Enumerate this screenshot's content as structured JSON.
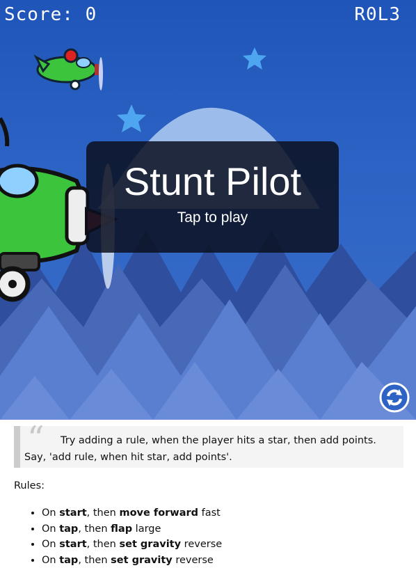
{
  "hud": {
    "score_label": "Score:",
    "score_value": "0",
    "level": "R0L3"
  },
  "overlay": {
    "title": "Stunt Pilot",
    "subtitle": "Tap to play"
  },
  "refresh": {
    "icon": "refresh-icon"
  },
  "quote": {
    "text": "Try adding a rule, when the player hits a star, then add points. Say, 'add rule, when hit star, add points'."
  },
  "rules": {
    "label": "Rules:",
    "items": [
      {
        "p1": "On ",
        "b1": "start",
        "p2": ", then ",
        "b2": "move forward",
        "p3": " fast"
      },
      {
        "p1": "On ",
        "b1": "tap",
        "p2": ", then ",
        "b2": "flap",
        "p3": " large"
      },
      {
        "p1": "On ",
        "b1": "start",
        "p2": ", then ",
        "b2": "set gravity",
        "p3": " reverse"
      },
      {
        "p1": "On ",
        "b1": "tap",
        "p2": ", then ",
        "b2": "set gravity",
        "p3": " reverse"
      }
    ]
  },
  "colors": {
    "sky": "#2c63c4",
    "trees_dark": "#2f4f9e",
    "trees_light": "#5b7fd0",
    "star": "#4ea6f0",
    "plane_green": "#3cc43c"
  }
}
